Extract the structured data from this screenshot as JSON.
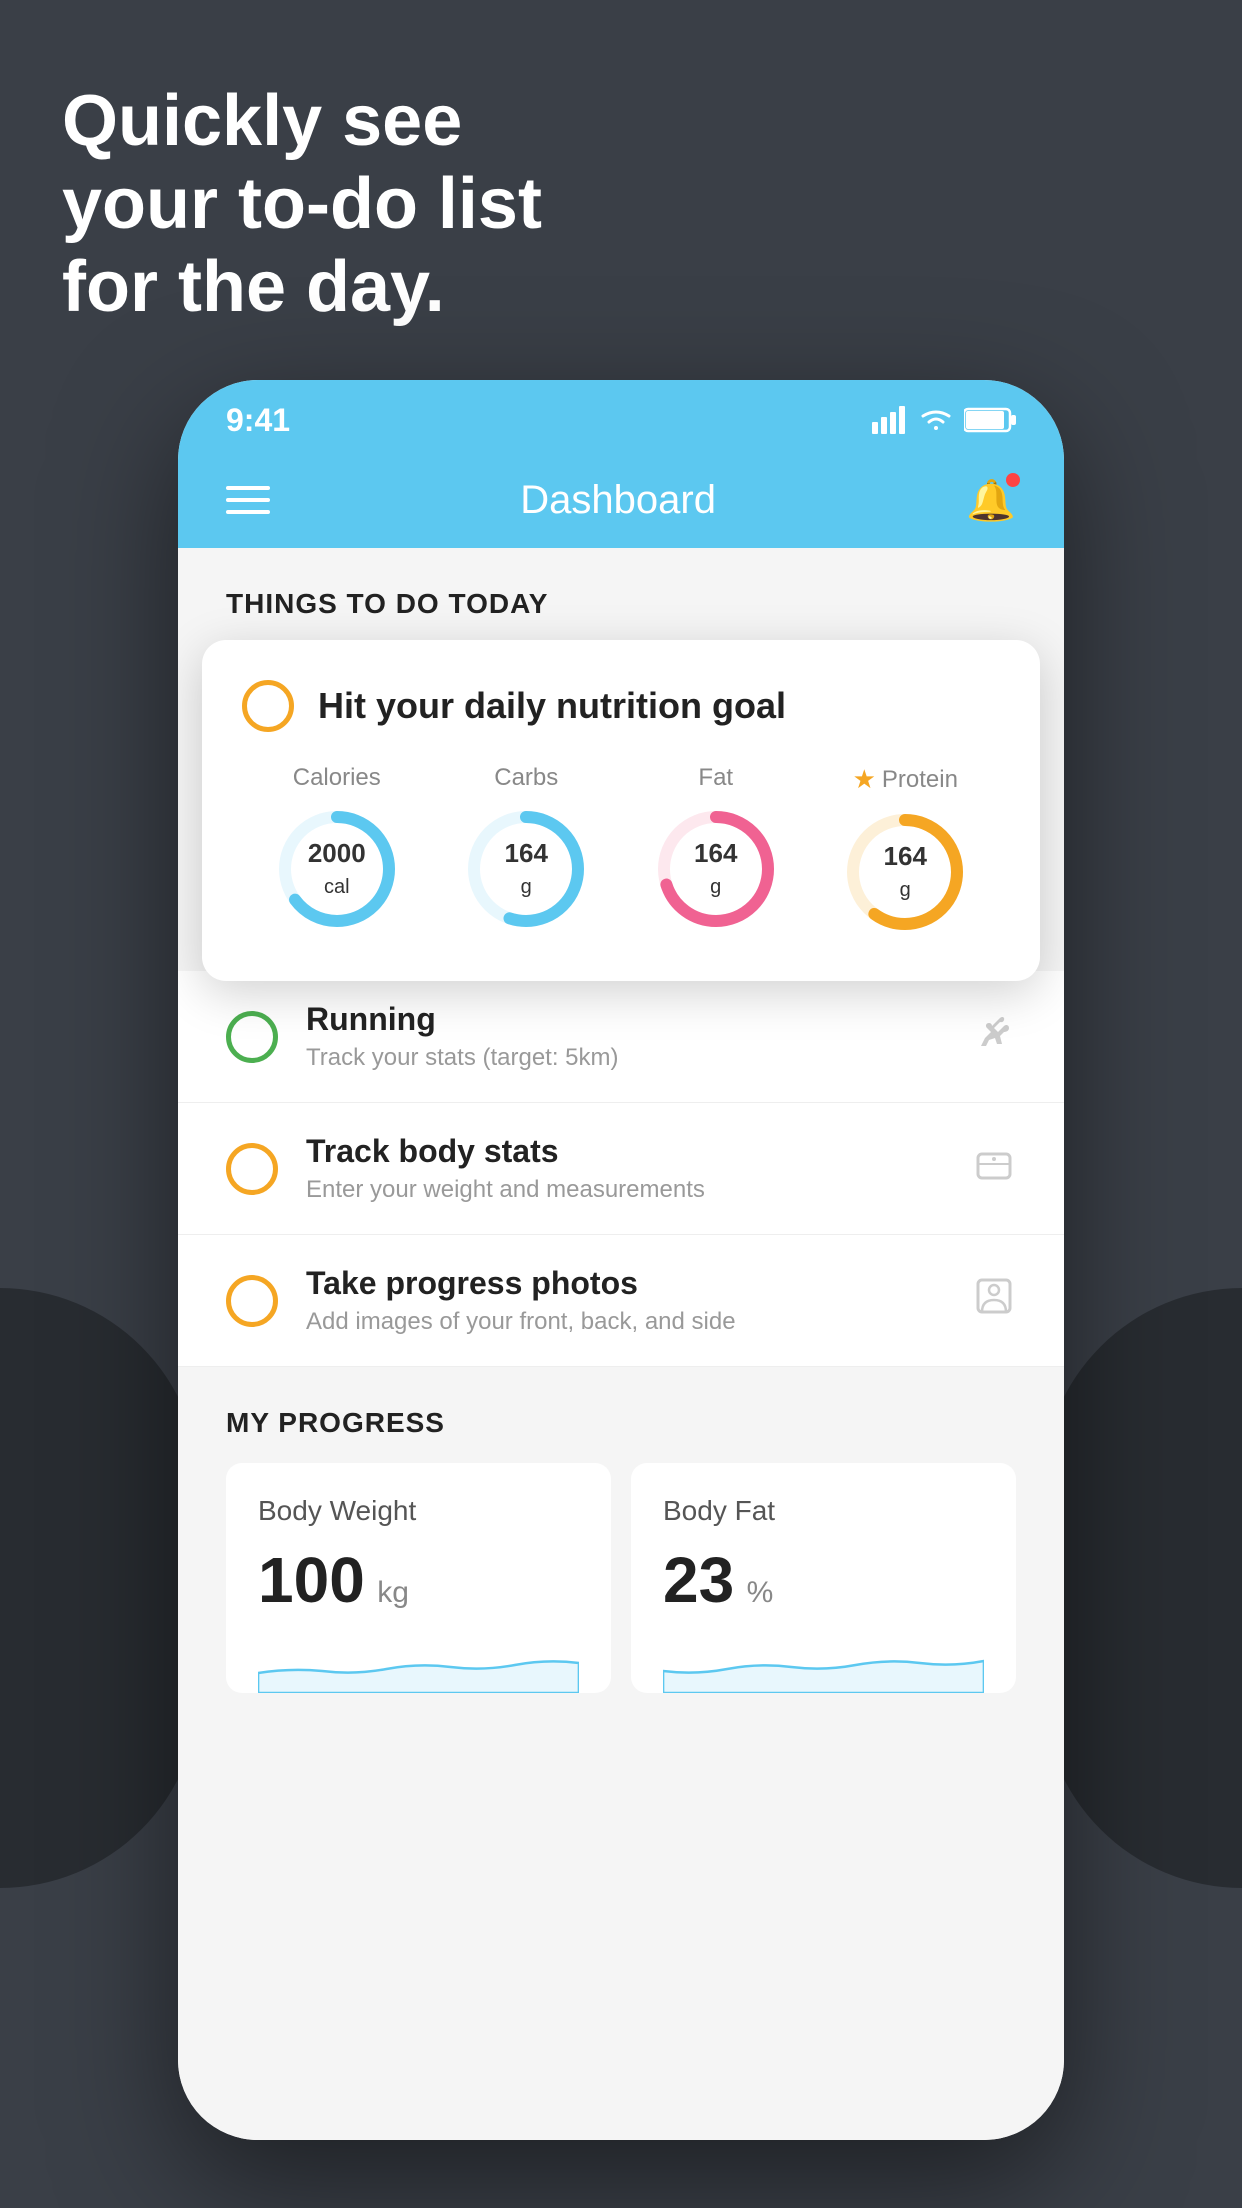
{
  "headline": {
    "line1": "Quickly see",
    "line2": "your to-do list",
    "line3": "for the day."
  },
  "statusBar": {
    "time": "9:41",
    "icons": "📶 ▪ 🔋"
  },
  "navBar": {
    "title": "Dashboard"
  },
  "thingsToDo": {
    "sectionHeader": "THINGS TO DO TODAY"
  },
  "nutritionCard": {
    "title": "Hit your daily nutrition goal",
    "metrics": [
      {
        "label": "Calories",
        "value": "2000",
        "unit": "cal",
        "color": "#5cc8f0",
        "percent": 65,
        "starred": false
      },
      {
        "label": "Carbs",
        "value": "164",
        "unit": "g",
        "color": "#5cc8f0",
        "percent": 55,
        "starred": false
      },
      {
        "label": "Fat",
        "value": "164",
        "unit": "g",
        "color": "#f06292",
        "percent": 70,
        "starred": false
      },
      {
        "label": "Protein",
        "value": "164",
        "unit": "g",
        "color": "#f5a623",
        "percent": 60,
        "starred": true
      }
    ]
  },
  "todoItems": [
    {
      "title": "Running",
      "subtitle": "Track your stats (target: 5km)",
      "circleColor": "green",
      "icon": "👟"
    },
    {
      "title": "Track body stats",
      "subtitle": "Enter your weight and measurements",
      "circleColor": "orange",
      "icon": "⚖"
    },
    {
      "title": "Take progress photos",
      "subtitle": "Add images of your front, back, and side",
      "circleColor": "orange",
      "icon": "👤"
    }
  ],
  "progress": {
    "sectionTitle": "MY PROGRESS",
    "cards": [
      {
        "title": "Body Weight",
        "value": "100",
        "unit": "kg"
      },
      {
        "title": "Body Fat",
        "value": "23",
        "unit": "%"
      }
    ]
  }
}
